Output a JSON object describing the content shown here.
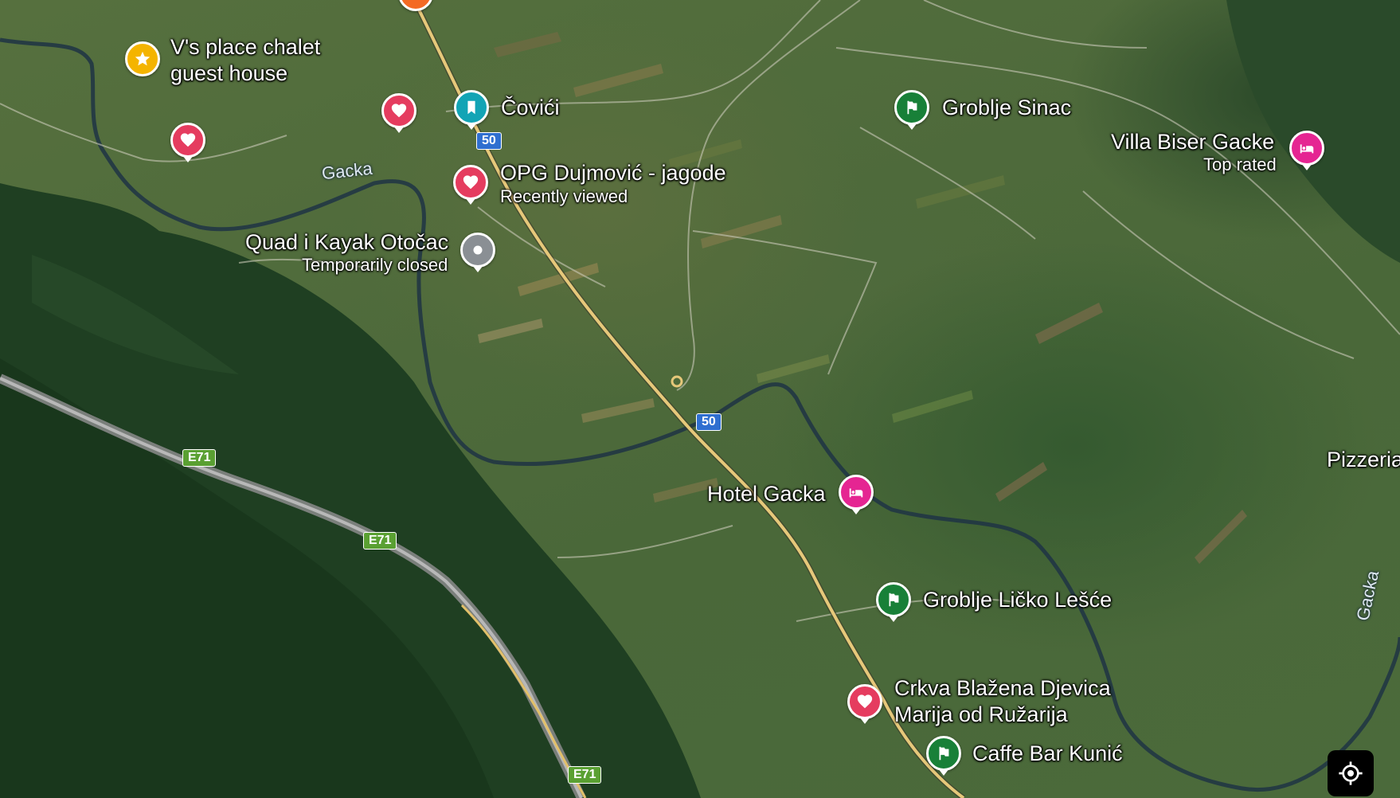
{
  "places": [
    {
      "id": "vs-place",
      "name_lines": [
        "V's place chalet",
        "guest house"
      ],
      "type": "starred",
      "color": "#f4b400",
      "icon": "star-icon"
    },
    {
      "id": "covici",
      "name": "Čovići",
      "type": "saved",
      "color": "#12a4b5",
      "icon": "bookmark-icon"
    },
    {
      "id": "groblje-sinac",
      "name": "Groblje Sinac",
      "type": "place",
      "color": "#188038",
      "icon": "flag-icon"
    },
    {
      "id": "villa-biser",
      "name": "Villa Biser Gacke",
      "sublabel": "Top rated",
      "type": "hotel",
      "color": "#e52592",
      "icon": "bed-icon"
    },
    {
      "id": "opg-dujmovic",
      "name": "OPG Dujmović - jagode",
      "sublabel": "Recently viewed",
      "type": "favorite",
      "color": "#e53c5f",
      "icon": "heart-icon"
    },
    {
      "id": "quad-kayak",
      "name": "Quad i Kayak Otočac",
      "sublabel": "Temporarily closed",
      "type": "closed",
      "color": "#8a8f94",
      "icon": "dot-icon"
    },
    {
      "id": "hotel-gacka",
      "name": "Hotel Gacka",
      "type": "hotel",
      "color": "#e52592",
      "icon": "bed-icon"
    },
    {
      "id": "groblje-licko",
      "name": "Groblje Ličko Lešće",
      "type": "place",
      "color": "#188038",
      "icon": "flag-icon"
    },
    {
      "id": "crkva",
      "name_lines": [
        "Crkva Blažena Djevica",
        "Marija od Ružarija"
      ],
      "type": "favorite",
      "color": "#e53c5f",
      "icon": "heart-icon"
    },
    {
      "id": "caffe-bar",
      "name": "Caffe Bar Kunić",
      "type": "place",
      "color": "#188038",
      "icon": "flag-icon"
    },
    {
      "id": "pizzeria",
      "name": "Pizzeria"
    }
  ],
  "unlabeled_favorites": 2,
  "road_shields": {
    "national": "50",
    "european": "E71"
  },
  "river_label": "Gacka",
  "controls": {
    "my_location": "my-location-icon"
  }
}
